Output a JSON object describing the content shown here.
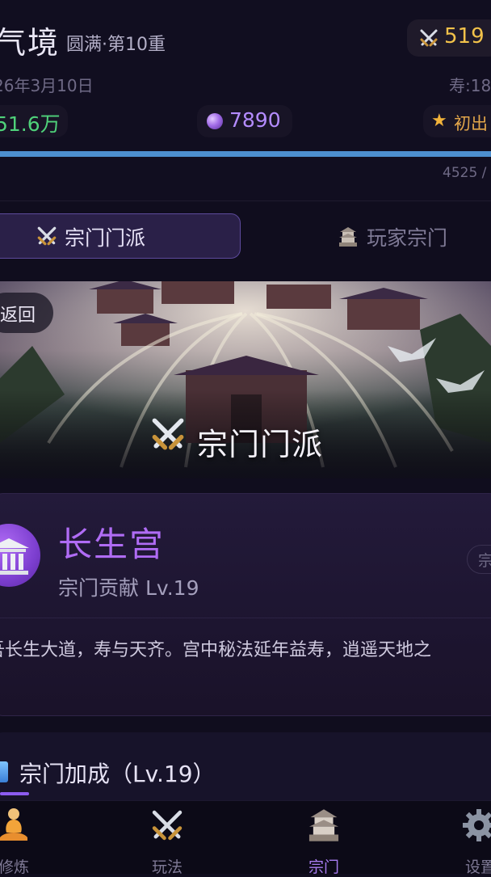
{
  "header": {
    "realm": "气境",
    "stage": "圆满·第10重",
    "power": "519",
    "date": "26年3月10日",
    "lifespan": "寿:18",
    "money": "51.6万",
    "orbs": "7890",
    "title": "初出",
    "exp_text": "4525 /",
    "exp_progress": 1.0
  },
  "tabs": [
    {
      "label": "宗门门派",
      "icon": "crossed-swords-icon",
      "active": true
    },
    {
      "label": "玩家宗门",
      "icon": "pagoda-icon",
      "active": false
    }
  ],
  "banner": {
    "back_label": "返回",
    "title": "宗门门派"
  },
  "sect": {
    "name": "长生宫",
    "contribution": "宗门贡献 Lv.19",
    "tag": "宗",
    "description": "吾长生大道，寿与天齐。宫中秘法延年益寿，逍遥天地之"
  },
  "bonus": {
    "title": "宗门加成（Lv.19）"
  },
  "nav": [
    {
      "label": "修炼",
      "icon": "meditating-person-icon",
      "active": false
    },
    {
      "label": "玩法",
      "icon": "crossed-swords-icon",
      "active": false
    },
    {
      "label": "宗门",
      "icon": "pagoda-icon",
      "active": true
    },
    {
      "label": "设置",
      "icon": "gear-icon",
      "active": false
    }
  ],
  "colors": {
    "background": "#100d1e",
    "accent_purple": "#b06cf5",
    "gold": "#f2c24a",
    "money_green": "#4fd27a",
    "exp_blue": "#4d8fcf"
  }
}
